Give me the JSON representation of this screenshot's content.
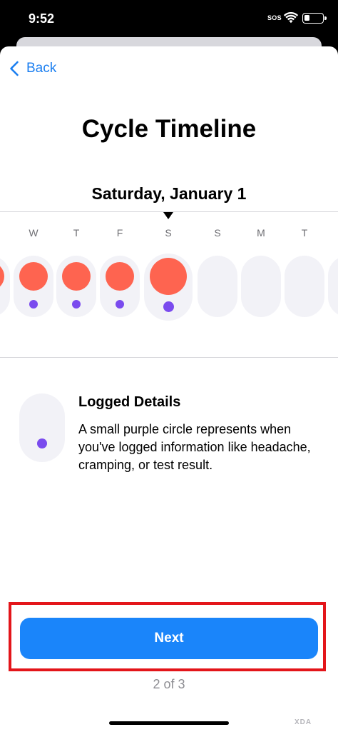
{
  "status_bar": {
    "time": "9:52",
    "carrier": "SOS",
    "icons": [
      "wifi-icon",
      "battery-icon"
    ]
  },
  "nav": {
    "back_label": "Back",
    "back_icon": "chevron-left-icon"
  },
  "page": {
    "title": "Cycle Timeline"
  },
  "timeline": {
    "selected_date": "Saturday, January 1",
    "day_letters": [
      "W",
      "T",
      "F",
      "S",
      "S",
      "M",
      "T"
    ],
    "days": [
      {
        "letter": "",
        "period": true,
        "logged": false,
        "selected": false
      },
      {
        "letter": "W",
        "period": true,
        "logged": true,
        "selected": false
      },
      {
        "letter": "T",
        "period": true,
        "logged": true,
        "selected": false
      },
      {
        "letter": "F",
        "period": true,
        "logged": true,
        "selected": false
      },
      {
        "letter": "S",
        "period": true,
        "logged": true,
        "selected": true
      },
      {
        "letter": "S",
        "period": false,
        "logged": false,
        "selected": false
      },
      {
        "letter": "M",
        "period": false,
        "logged": false,
        "selected": false
      },
      {
        "letter": "T",
        "period": false,
        "logged": false,
        "selected": false
      },
      {
        "letter": "",
        "period": false,
        "logged": false,
        "selected": false
      }
    ]
  },
  "legend": {
    "title": "Logged Details",
    "description": "A small purple circle represents when you've logged information like headache, cramping, or test result."
  },
  "footer": {
    "next_label": "Next",
    "page_indicator": "2 of 3"
  },
  "colors": {
    "accent": "#1a85fa",
    "period": "#fe6450",
    "logged": "#7a4bee",
    "pill_bg": "#f2f2f7",
    "highlight": "#e3151a"
  },
  "watermark": "XDA"
}
